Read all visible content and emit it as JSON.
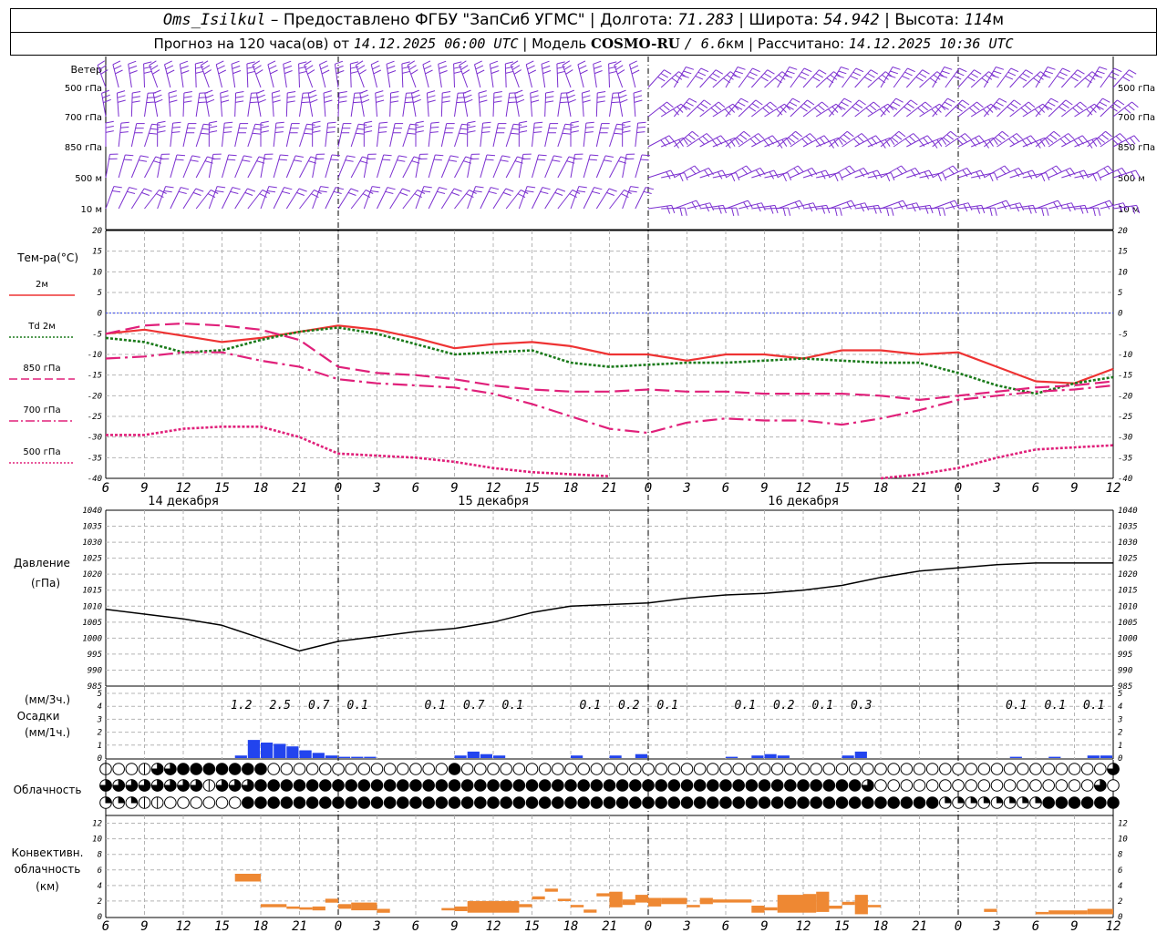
{
  "header": {
    "station": "Oms_Isilkul",
    "provider": "– Предоставлено ФГБУ \"ЗапСиб УГМС\"",
    "lon_label": "Долгота:",
    "lon_value": "71.283",
    "lat_label": "Широта:",
    "lat_value": "54.942",
    "alt_label": "Высота:",
    "alt_value": "114",
    "alt_unit": "м",
    "forecast_prefix": "Прогноз на 120 часа(ов) от",
    "forecast_time": "14.12.2025 06:00 UTC",
    "model_label": "| Модель",
    "model_name": "COSMO-RU",
    "model_res": "/ 6.6",
    "model_res_unit": "км",
    "calc_label": "| Рассчитано:",
    "calc_time": "14.12.2025 10:36 UTC"
  },
  "chart_data": {
    "type": "meteogram",
    "x_hour_labels": [
      "6",
      "9",
      "12",
      "15",
      "18",
      "21",
      "0",
      "3",
      "6",
      "9",
      "12",
      "15",
      "18",
      "21",
      "0",
      "3",
      "6",
      "9",
      "12",
      "15",
      "18",
      "21",
      "0",
      "3",
      "6",
      "9",
      "12"
    ],
    "day_labels": [
      "14 декабря",
      "15 декабря",
      "16 декабря"
    ],
    "day_label_offsets_h": [
      6,
      30,
      54
    ],
    "day_boundaries_h": [
      18,
      42,
      66
    ],
    "wind": {
      "title": "Ветер",
      "levels": [
        "500 гПа",
        "700 гПа",
        "850 гПа",
        "500 м",
        "10 м"
      ],
      "color": "#7b2fd0"
    },
    "temperature": {
      "title": "Тем-ра(°C)",
      "ylim": [
        -40,
        20
      ],
      "ticks": [
        20,
        15,
        10,
        5,
        0,
        -5,
        -10,
        -15,
        -20,
        -25,
        -30,
        -35,
        -40
      ],
      "legend": [
        {
          "name": "2м",
          "color": "#ee3333",
          "style": "solid"
        },
        {
          "name": "Td 2м",
          "color": "#1a7a1a",
          "style": "dotted"
        },
        {
          "name": "850 гПа",
          "color": "#e0207a",
          "style": "dashed"
        },
        {
          "name": "700 гПа",
          "color": "#e0207a",
          "style": "dashdot"
        },
        {
          "name": "500 гПа",
          "color": "#e0207a",
          "style": "dotted"
        }
      ],
      "hours": [
        0,
        3,
        6,
        9,
        12,
        15,
        18,
        21,
        24,
        27,
        30,
        33,
        36,
        39,
        42,
        45,
        48,
        51,
        54,
        57,
        60,
        63,
        66,
        69,
        72,
        75,
        78
      ],
      "series": {
        "t2m": [
          -5,
          -4,
          -5.5,
          -7,
          -6,
          -4.5,
          -3,
          -4,
          -6,
          -8.5,
          -7.5,
          -7,
          -8,
          -10,
          -10,
          -11.5,
          -10,
          -10,
          -11,
          -9,
          -9,
          -10,
          -9.5,
          -13,
          -16.5,
          -17,
          -13.5
        ],
        "td2m": [
          -6,
          -7,
          -9.5,
          -9,
          -6.5,
          -4.5,
          -3.5,
          -5,
          -7.5,
          -10,
          -9.5,
          -9,
          -12,
          -13,
          -12.5,
          -12,
          -12,
          -11.5,
          -11,
          -11.5,
          -12,
          -12,
          -14.5,
          -17.5,
          -19.5,
          -17,
          -15.5
        ],
        "t850": [
          -5,
          -3,
          -2.5,
          -3,
          -4,
          -6.5,
          -13,
          -14.5,
          -15,
          -16,
          -17.5,
          -18.5,
          -19,
          -19,
          -18.5,
          -19,
          -19,
          -19.5,
          -19.5,
          -19.5,
          -20,
          -21,
          -20,
          -19,
          -18,
          -17.5,
          -16.5
        ],
        "t700": [
          -11,
          -10.5,
          -9.5,
          -9.5,
          -11.5,
          -13,
          -16,
          -17,
          -17.5,
          -18,
          -19.5,
          -22,
          -25,
          -28,
          -29,
          -26.5,
          -25.5,
          -26,
          -26,
          -27,
          -25.5,
          -23.5,
          -21,
          -20,
          -19,
          -18.5,
          -17.5
        ],
        "t500": [
          -29.5,
          -29.5,
          -28,
          -27.5,
          -27.5,
          -30,
          -34,
          -34.5,
          -35,
          -36,
          -37.5,
          -38.5,
          -39,
          -39.5,
          null,
          null,
          null,
          null,
          null,
          null,
          -40,
          -39,
          -37.5,
          -35,
          -33,
          -32.5,
          -32
        ]
      }
    },
    "pressure": {
      "title": "Давление",
      "unit": "(гПа)",
      "ylim": [
        985,
        1040
      ],
      "ticks": [
        1040,
        1035,
        1030,
        1025,
        1020,
        1015,
        1010,
        1005,
        1000,
        995,
        990,
        985
      ],
      "hours": [
        0,
        3,
        6,
        9,
        12,
        15,
        18,
        21,
        24,
        27,
        30,
        33,
        36,
        39,
        42,
        45,
        48,
        51,
        54,
        57,
        60,
        63,
        66,
        69,
        72,
        75,
        78
      ],
      "values": [
        1009,
        1007.5,
        1006,
        1004,
        1000,
        996,
        999,
        1000.5,
        1002,
        1003,
        1005,
        1008,
        1010,
        1010.5,
        1011,
        1012.5,
        1013.5,
        1014,
        1015,
        1016.5,
        1019,
        1021,
        1022,
        1023,
        1023.5,
        1023.5,
        1023.5
      ]
    },
    "precip": {
      "label_top": "(мм/3ч.)",
      "label_mid": "Осадки",
      "label_bot": "(мм/1ч.)",
      "ylim": [
        0,
        5
      ],
      "ticks": [
        5,
        4,
        3,
        2,
        1,
        0
      ],
      "color": "#2244ee",
      "totals_3h": [
        {
          "h": 10.5,
          "text": "1.2"
        },
        {
          "h": 13.5,
          "text": "2.5"
        },
        {
          "h": 16.5,
          "text": "0.7"
        },
        {
          "h": 19.5,
          "text": "0.1"
        },
        {
          "h": 25.5,
          "text": "0.1"
        },
        {
          "h": 28.5,
          "text": "0.7"
        },
        {
          "h": 31.5,
          "text": "0.1"
        },
        {
          "h": 37.5,
          "text": "0.1"
        },
        {
          "h": 40.5,
          "text": "0.2"
        },
        {
          "h": 43.5,
          "text": "0.1"
        },
        {
          "h": 49.5,
          "text": "0.1"
        },
        {
          "h": 52.5,
          "text": "0.2"
        },
        {
          "h": 55.5,
          "text": "0.1"
        },
        {
          "h": 58.5,
          "text": "0.3"
        },
        {
          "h": 70.5,
          "text": "0.1"
        },
        {
          "h": 73.5,
          "text": "0.1"
        },
        {
          "h": 76.5,
          "text": "0.1"
        }
      ],
      "hourly": [
        {
          "h": 10,
          "v": 0.2
        },
        {
          "h": 11,
          "v": 1.4
        },
        {
          "h": 12,
          "v": 1.2
        },
        {
          "h": 13,
          "v": 1.1
        },
        {
          "h": 14,
          "v": 0.9
        },
        {
          "h": 15,
          "v": 0.6
        },
        {
          "h": 16,
          "v": 0.4
        },
        {
          "h": 17,
          "v": 0.2
        },
        {
          "h": 18,
          "v": 0.1
        },
        {
          "h": 19,
          "v": 0.1
        },
        {
          "h": 20,
          "v": 0.1
        },
        {
          "h": 27,
          "v": 0.2
        },
        {
          "h": 28,
          "v": 0.5
        },
        {
          "h": 29,
          "v": 0.3
        },
        {
          "h": 30,
          "v": 0.2
        },
        {
          "h": 36,
          "v": 0.2
        },
        {
          "h": 39,
          "v": 0.2
        },
        {
          "h": 41,
          "v": 0.3
        },
        {
          "h": 48,
          "v": 0.1
        },
        {
          "h": 50,
          "v": 0.2
        },
        {
          "h": 51,
          "v": 0.3
        },
        {
          "h": 52,
          "v": 0.2
        },
        {
          "h": 57,
          "v": 0.2
        },
        {
          "h": 58,
          "v": 0.5
        },
        {
          "h": 70,
          "v": 0.1
        },
        {
          "h": 73,
          "v": 0.1
        },
        {
          "h": 76,
          "v": 0.2
        },
        {
          "h": 77,
          "v": 0.2
        }
      ]
    },
    "cloudiness": {
      "title": "Облачность",
      "rows": [
        [
          1,
          0,
          0,
          1,
          3,
          3,
          4,
          4,
          4,
          4,
          4,
          4,
          4,
          0,
          0,
          0,
          0,
          0,
          0,
          0,
          0,
          0,
          0,
          0,
          0,
          0,
          0,
          4,
          0,
          0,
          0,
          0,
          0,
          0,
          0,
          0,
          0,
          0,
          0,
          0,
          0,
          0,
          0,
          0,
          0,
          0,
          0,
          0,
          0,
          0,
          0,
          0,
          0,
          0,
          0,
          0,
          0,
          0,
          0,
          0,
          0,
          0,
          0,
          0,
          0,
          0,
          0,
          0,
          0,
          0,
          0,
          0,
          0,
          0,
          0,
          0,
          0,
          0,
          3
        ],
        [
          3,
          3,
          3,
          3,
          3,
          3,
          3,
          3,
          1,
          3,
          3,
          3,
          4,
          4,
          4,
          4,
          4,
          4,
          4,
          4,
          4,
          4,
          4,
          4,
          4,
          4,
          4,
          4,
          4,
          4,
          4,
          4,
          4,
          4,
          4,
          4,
          4,
          4,
          4,
          4,
          4,
          4,
          4,
          4,
          4,
          4,
          4,
          4,
          4,
          4,
          4,
          4,
          4,
          4,
          4,
          4,
          4,
          4,
          4,
          3,
          0,
          0,
          0,
          0,
          0,
          0,
          0,
          0,
          0,
          0,
          0,
          0,
          0,
          0,
          0,
          0,
          0,
          3,
          0
        ],
        [
          2,
          2,
          2,
          1,
          1,
          0,
          0,
          0,
          0,
          0,
          0,
          4,
          4,
          4,
          4,
          4,
          4,
          4,
          4,
          4,
          4,
          4,
          4,
          4,
          4,
          4,
          4,
          4,
          4,
          4,
          4,
          4,
          4,
          4,
          4,
          4,
          4,
          4,
          4,
          4,
          4,
          4,
          4,
          4,
          4,
          4,
          4,
          4,
          4,
          4,
          4,
          4,
          4,
          4,
          4,
          4,
          4,
          4,
          4,
          4,
          4,
          4,
          4,
          4,
          4,
          2,
          2,
          2,
          2,
          2,
          2,
          2,
          2,
          4,
          4,
          4,
          4,
          4,
          4
        ]
      ]
    },
    "convective": {
      "label1": "Конвективн.",
      "label2": "облачность",
      "label3": "(км)",
      "ylim": [
        0,
        13
      ],
      "ticks": [
        12,
        10,
        8,
        6,
        4,
        2,
        0
      ],
      "color": "#ee8833",
      "bars": [
        {
          "h0": 10,
          "h1": 12,
          "lo": 4.5,
          "hi": 5.5
        },
        {
          "h0": 12,
          "h1": 14,
          "lo": 1.2,
          "hi": 1.6
        },
        {
          "h0": 14,
          "h1": 15,
          "lo": 1.0,
          "hi": 1.3
        },
        {
          "h0": 15,
          "h1": 16,
          "lo": 0.9,
          "hi": 1.2
        },
        {
          "h0": 16,
          "h1": 17,
          "lo": 0.8,
          "hi": 1.3
        },
        {
          "h0": 17,
          "h1": 18,
          "lo": 1.8,
          "hi": 2.3
        },
        {
          "h0": 18,
          "h1": 19,
          "lo": 1.0,
          "hi": 1.6
        },
        {
          "h0": 19,
          "h1": 21,
          "lo": 0.8,
          "hi": 1.8
        },
        {
          "h0": 21,
          "h1": 22,
          "lo": 0.5,
          "hi": 1.0
        },
        {
          "h0": 26,
          "h1": 27,
          "lo": 0.8,
          "hi": 1.1
        },
        {
          "h0": 27,
          "h1": 28,
          "lo": 0.7,
          "hi": 1.3
        },
        {
          "h0": 28,
          "h1": 32,
          "lo": 0.5,
          "hi": 2.0
        },
        {
          "h0": 32,
          "h1": 33,
          "lo": 1.2,
          "hi": 1.6
        },
        {
          "h0": 33,
          "h1": 34,
          "lo": 2.2,
          "hi": 2.6
        },
        {
          "h0": 34,
          "h1": 35,
          "lo": 3.2,
          "hi": 3.6
        },
        {
          "h0": 35,
          "h1": 36,
          "lo": 2.0,
          "hi": 2.3
        },
        {
          "h0": 36,
          "h1": 37,
          "lo": 1.2,
          "hi": 1.5
        },
        {
          "h0": 37,
          "h1": 38,
          "lo": 0.5,
          "hi": 0.9
        },
        {
          "h0": 38,
          "h1": 39,
          "lo": 2.6,
          "hi": 3.0
        },
        {
          "h0": 39,
          "h1": 40,
          "lo": 1.2,
          "hi": 3.2
        },
        {
          "h0": 40,
          "h1": 41,
          "lo": 1.5,
          "hi": 2.2
        },
        {
          "h0": 41,
          "h1": 42,
          "lo": 1.8,
          "hi": 2.8
        },
        {
          "h0": 42,
          "h1": 43,
          "lo": 1.3,
          "hi": 2.4
        },
        {
          "h0": 43,
          "h1": 45,
          "lo": 1.6,
          "hi": 2.4
        },
        {
          "h0": 45,
          "h1": 46,
          "lo": 1.2,
          "hi": 1.5
        },
        {
          "h0": 46,
          "h1": 47,
          "lo": 1.6,
          "hi": 2.4
        },
        {
          "h0": 47,
          "h1": 50,
          "lo": 1.8,
          "hi": 2.2
        },
        {
          "h0": 50,
          "h1": 51,
          "lo": 0.5,
          "hi": 1.4
        },
        {
          "h0": 51,
          "h1": 52,
          "lo": 0.8,
          "hi": 1.2
        },
        {
          "h0": 52,
          "h1": 54,
          "lo": 0.5,
          "hi": 2.8
        },
        {
          "h0": 54,
          "h1": 55,
          "lo": 0.5,
          "hi": 2.9
        },
        {
          "h0": 55,
          "h1": 56,
          "lo": 0.6,
          "hi": 3.2
        },
        {
          "h0": 56,
          "h1": 57,
          "lo": 1.0,
          "hi": 1.4
        },
        {
          "h0": 57,
          "h1": 58,
          "lo": 1.5,
          "hi": 1.9
        },
        {
          "h0": 58,
          "h1": 59,
          "lo": 0.3,
          "hi": 2.8
        },
        {
          "h0": 59,
          "h1": 60,
          "lo": 1.2,
          "hi": 1.5
        },
        {
          "h0": 68,
          "h1": 69,
          "lo": 0.6,
          "hi": 1.0
        },
        {
          "h0": 72,
          "h1": 73,
          "lo": 0.3,
          "hi": 0.6
        },
        {
          "h0": 73,
          "h1": 76,
          "lo": 0.3,
          "hi": 0.8
        },
        {
          "h0": 76,
          "h1": 78,
          "lo": 0.3,
          "hi": 1.0
        }
      ]
    }
  }
}
